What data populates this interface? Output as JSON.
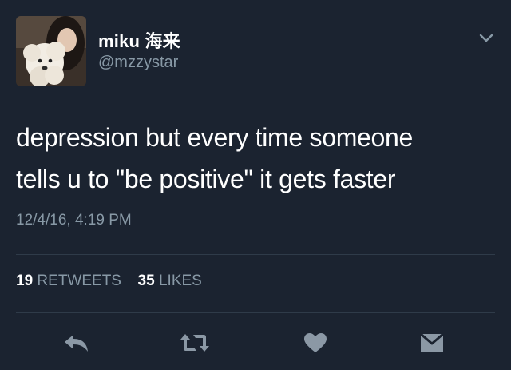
{
  "user": {
    "display_name": "miku 海来",
    "handle": "@mzzystar"
  },
  "tweet": {
    "text_lines": [
      "depression but every time someone",
      "tells u to \"be positive\" it gets faster"
    ],
    "timestamp": "12/4/16, 4:19 PM"
  },
  "stats": {
    "retweets_count": "19",
    "retweets_label": "RETWEETS",
    "likes_count": "35",
    "likes_label": "LIKES"
  },
  "actions": {
    "reply_icon": "reply-icon",
    "retweet_icon": "retweet-icon",
    "like_icon": "heart-icon",
    "dm_icon": "direct-message-icon"
  },
  "colors": {
    "background": "#1b2330",
    "text": "#ffffff",
    "secondary": "#8899a6",
    "divider": "#2f3b49",
    "icon": "#8b98a5"
  }
}
